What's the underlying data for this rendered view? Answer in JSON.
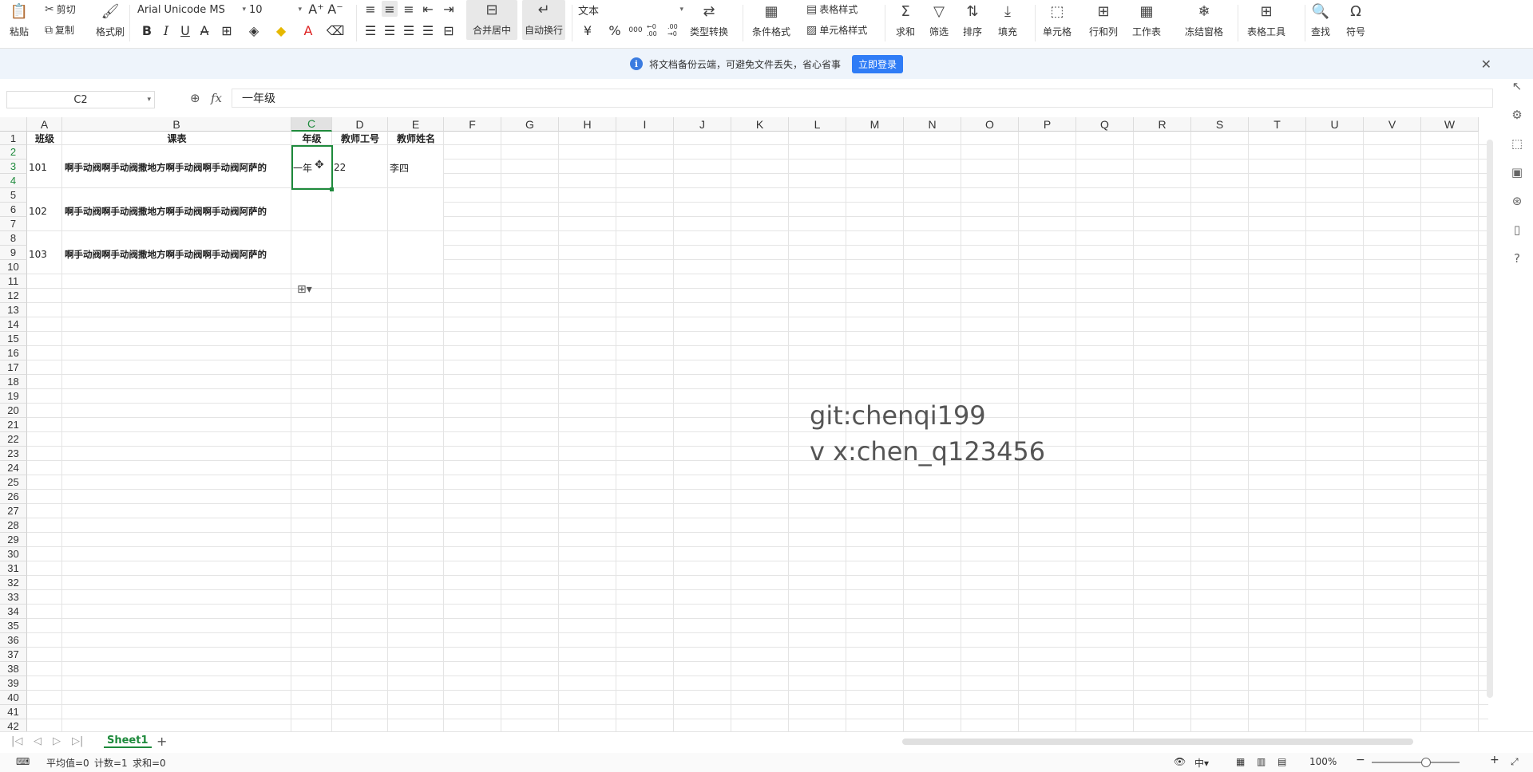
{
  "ribbon": {
    "paste": "粘贴",
    "cut": "剪切",
    "copy": "复制",
    "format_painter": "格式刷",
    "font_name": "Arial Unicode MS",
    "font_size": "10",
    "bold": "B",
    "italic": "I",
    "underline": "U",
    "merge_center": "合并居中",
    "auto_wrap": "自动换行",
    "number_format": "文本",
    "currency_symbol": "¥",
    "percent_symbol": "%",
    "thousands": "000",
    "increase_decimal": "←0 .00",
    "decrease_decimal": ".00 →0",
    "type_convert": "类型转换",
    "conditional_format": "条件格式",
    "table_style": "表格样式",
    "cell_style": "单元格样式",
    "sum": "求和",
    "filter": "筛选",
    "sort": "排序",
    "fill": "填充",
    "cell": "单元格",
    "row_col": "行和列",
    "worksheet": "工作表",
    "freeze": "冻结窗格",
    "table_tools": "表格工具",
    "find": "查找",
    "symbol": "符号"
  },
  "banner": {
    "message": "将文档备份云端，可避免文件丢失，省心省事",
    "login_button": "立即登录"
  },
  "formula_bar": {
    "name_box": "C2",
    "fx": "fx",
    "content": "一年级"
  },
  "columns": [
    "A",
    "B",
    "C",
    "D",
    "E",
    "F",
    "G",
    "H",
    "I",
    "J",
    "K",
    "L",
    "M",
    "N",
    "O",
    "P",
    "Q",
    "R",
    "S",
    "T",
    "U",
    "V",
    "W"
  ],
  "selected_column": "C",
  "rows": [
    "1",
    "2",
    "3",
    "4",
    "5",
    "6",
    "7",
    "8",
    "9",
    "10",
    "11",
    "12",
    "13",
    "14",
    "15",
    "16",
    "17",
    "18",
    "19",
    "20",
    "21",
    "22",
    "23",
    "24",
    "25",
    "26",
    "27",
    "28",
    "29",
    "30",
    "31",
    "32",
    "33",
    "34",
    "35",
    "36",
    "37",
    "38",
    "39",
    "40",
    "41",
    "42"
  ],
  "selected_rows": [
    "2",
    "3",
    "4"
  ],
  "table": {
    "headers": [
      "班级",
      "课表",
      "年级",
      "教师工号",
      "教师姓名"
    ],
    "records": [
      {
        "class": "101",
        "schedule": "啊手动阀啊手动阀撒地方啊手动阀啊手动阀阿萨的",
        "grade": "一年",
        "teacher_id": "22",
        "teacher_name": "李四"
      },
      {
        "class": "102",
        "schedule": "啊手动阀啊手动阀撒地方啊手动阀啊手动阀阿萨的",
        "grade": "",
        "teacher_id": "",
        "teacher_name": ""
      },
      {
        "class": "103",
        "schedule": "啊手动阀啊手动阀撒地方啊手动阀啊手动阀阿萨的",
        "grade": "",
        "teacher_id": "",
        "teacher_name": ""
      }
    ]
  },
  "watermark": {
    "line1": "git:chenqi199",
    "line2": "v x:chen_q123456"
  },
  "sheet_tabs": {
    "active": "Sheet1",
    "add": "+"
  },
  "status_bar": {
    "average": "平均值=0",
    "count": "计数=1",
    "sum": "求和=0",
    "zoom": "100%"
  },
  "colors": {
    "accent_green": "#1e8a3c",
    "banner_button": "#2f7cf6",
    "banner_bg": "#eef4fb"
  }
}
